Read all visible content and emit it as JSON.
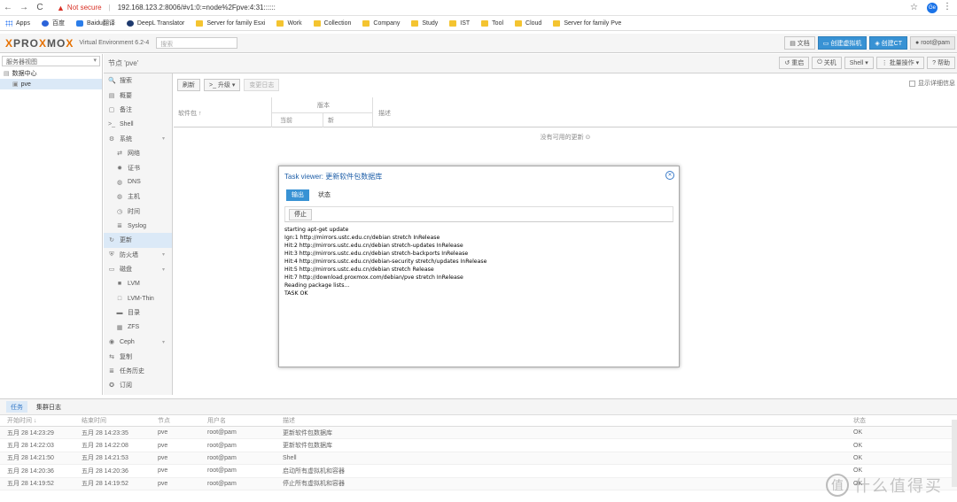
{
  "browser": {
    "back": "←",
    "forward": "→",
    "reload": "C",
    "warning": "Not secure",
    "url": "192.168.123.2:8006/#v1:0:=node%2Fpve:4:31::::::",
    "profile": "Ge",
    "bookmarks": [
      {
        "label": "Apps",
        "icon": "grid"
      },
      {
        "label": "百度",
        "icon": "paw"
      },
      {
        "label": "Baidu翻译",
        "icon": "blue"
      },
      {
        "label": "DeepL Translator",
        "icon": "dark"
      },
      {
        "label": "Server for family Esxi",
        "icon": "folder"
      },
      {
        "label": "Work",
        "icon": "folder"
      },
      {
        "label": "Collection",
        "icon": "folder"
      },
      {
        "label": "Company",
        "icon": "folder"
      },
      {
        "label": "Study",
        "icon": "folder"
      },
      {
        "label": "IST",
        "icon": "folder"
      },
      {
        "label": "Tool",
        "icon": "folder"
      },
      {
        "label": "Cloud",
        "icon": "folder"
      },
      {
        "label": "Server for family Pve",
        "icon": "folder"
      }
    ]
  },
  "pve": {
    "logo_pre": "PRO",
    "logo_x": "X",
    "logo_mid": "MO",
    "logo_x2": "X",
    "version": "Virtual Environment 6.2-4",
    "search_placeholder": "搜索",
    "header_buttons": [
      "文档",
      "创建虚拟机",
      "创建CT",
      "root@pam"
    ]
  },
  "tree": {
    "view": "服务器视图",
    "datacenter": "数据中心",
    "node": "pve"
  },
  "node": {
    "title": "节点 'pve'",
    "buttons": [
      "重启",
      "关机",
      "Shell",
      "批量操作",
      "帮助"
    ]
  },
  "sidenav": [
    {
      "label": "搜索",
      "icon": "search-icon",
      "glyph": "🔍",
      "sub": false
    },
    {
      "label": "概要",
      "icon": "book-icon",
      "glyph": "▤",
      "sub": false
    },
    {
      "label": "备注",
      "icon": "note-icon",
      "glyph": "▢",
      "sub": false
    },
    {
      "label": "Shell",
      "icon": "terminal-icon",
      "glyph": ">_",
      "sub": false
    },
    {
      "label": "系统",
      "icon": "cogs-icon",
      "glyph": "⚙",
      "sub": false,
      "chev": true
    },
    {
      "label": "网络",
      "icon": "exchange-icon",
      "glyph": "⇄",
      "sub": true
    },
    {
      "label": "证书",
      "icon": "certificate-icon",
      "glyph": "✹",
      "sub": true
    },
    {
      "label": "DNS",
      "icon": "globe-icon",
      "glyph": "◍",
      "sub": true
    },
    {
      "label": "主机",
      "icon": "globe-icon",
      "glyph": "◍",
      "sub": true
    },
    {
      "label": "时间",
      "icon": "clock-icon",
      "glyph": "◷",
      "sub": true
    },
    {
      "label": "Syslog",
      "icon": "list-icon",
      "glyph": "≣",
      "sub": true
    },
    {
      "label": "更新",
      "icon": "refresh-icon",
      "glyph": "↻",
      "sub": false,
      "selected": true
    },
    {
      "label": "防火墙",
      "icon": "shield-icon",
      "glyph": "⛨",
      "sub": false,
      "chev": true
    },
    {
      "label": "磁盘",
      "icon": "hdd-icon",
      "glyph": "▭",
      "sub": false,
      "chev": true
    },
    {
      "label": "LVM",
      "icon": "square-icon",
      "glyph": "■",
      "sub": true
    },
    {
      "label": "LVM-Thin",
      "icon": "square-outline-icon",
      "glyph": "□",
      "sub": true
    },
    {
      "label": "目录",
      "icon": "folder-icon",
      "glyph": "▬",
      "sub": true
    },
    {
      "label": "ZFS",
      "icon": "th-large-icon",
      "glyph": "▦",
      "sub": true
    },
    {
      "label": "Ceph",
      "icon": "ceph-icon",
      "glyph": "◉",
      "sub": false,
      "chev": true
    },
    {
      "label": "复制",
      "icon": "retweet-icon",
      "glyph": "⇆",
      "sub": false
    },
    {
      "label": "任务历史",
      "icon": "list-icon",
      "glyph": "≣",
      "sub": false
    },
    {
      "label": "订阅",
      "icon": "support-icon",
      "glyph": "✪",
      "sub": false
    }
  ],
  "updates": {
    "refresh": "刷新",
    "upgrade": "升级",
    "changelog": "变更日志",
    "show_details": "显示详细信息",
    "col_package": "软件包 ↑",
    "col_version": "版本",
    "col_current": "当前",
    "col_new": "新",
    "col_desc": "描述",
    "empty": "没有可用的更新 ⊙"
  },
  "task": {
    "title": "Task viewer: 更新软件包数据库",
    "tab_output": "输出",
    "tab_status": "状态",
    "stop": "停止",
    "log": [
      "starting apt-get update",
      "Ign:1 http://mirrors.ustc.edu.cn/debian stretch InRelease",
      "Hit:2 http://mirrors.ustc.edu.cn/debian stretch-updates InRelease",
      "Hit:3 http://mirrors.ustc.edu.cn/debian stretch-backports InRelease",
      "Hit:4 http://mirrors.ustc.edu.cn/debian-security stretch/updates InRelease",
      "Hit:5 http://mirrors.ustc.edu.cn/debian stretch Release",
      "Hit:7 http://download.proxmox.com/debian/pve stretch InRelease",
      "Reading package lists...",
      "TASK OK"
    ]
  },
  "bottom": {
    "tab_tasks": "任务",
    "tab_cluster_log": "集群日志",
    "headers": [
      "开始时间 ↓",
      "结束时间",
      "节点",
      "用户名",
      "描述",
      "状态"
    ],
    "rows": [
      [
        "五月 28 14:23:29",
        "五月 28 14:23:35",
        "pve",
        "root@pam",
        "更新软件包数据库",
        "OK"
      ],
      [
        "五月 28 14:22:03",
        "五月 28 14:22:08",
        "pve",
        "root@pam",
        "更新软件包数据库",
        "OK"
      ],
      [
        "五月 28 14:21:50",
        "五月 28 14:21:53",
        "pve",
        "root@pam",
        "Shell",
        "OK"
      ],
      [
        "五月 28 14:20:36",
        "五月 28 14:20:36",
        "pve",
        "root@pam",
        "启动所有虚拟机和容器",
        "OK"
      ],
      [
        "五月 28 14:19:52",
        "五月 28 14:19:52",
        "pve",
        "root@pam",
        "停止所有虚拟机和容器",
        "OK"
      ]
    ]
  },
  "watermark": {
    "symbol": "值",
    "text": "什么值得买"
  }
}
